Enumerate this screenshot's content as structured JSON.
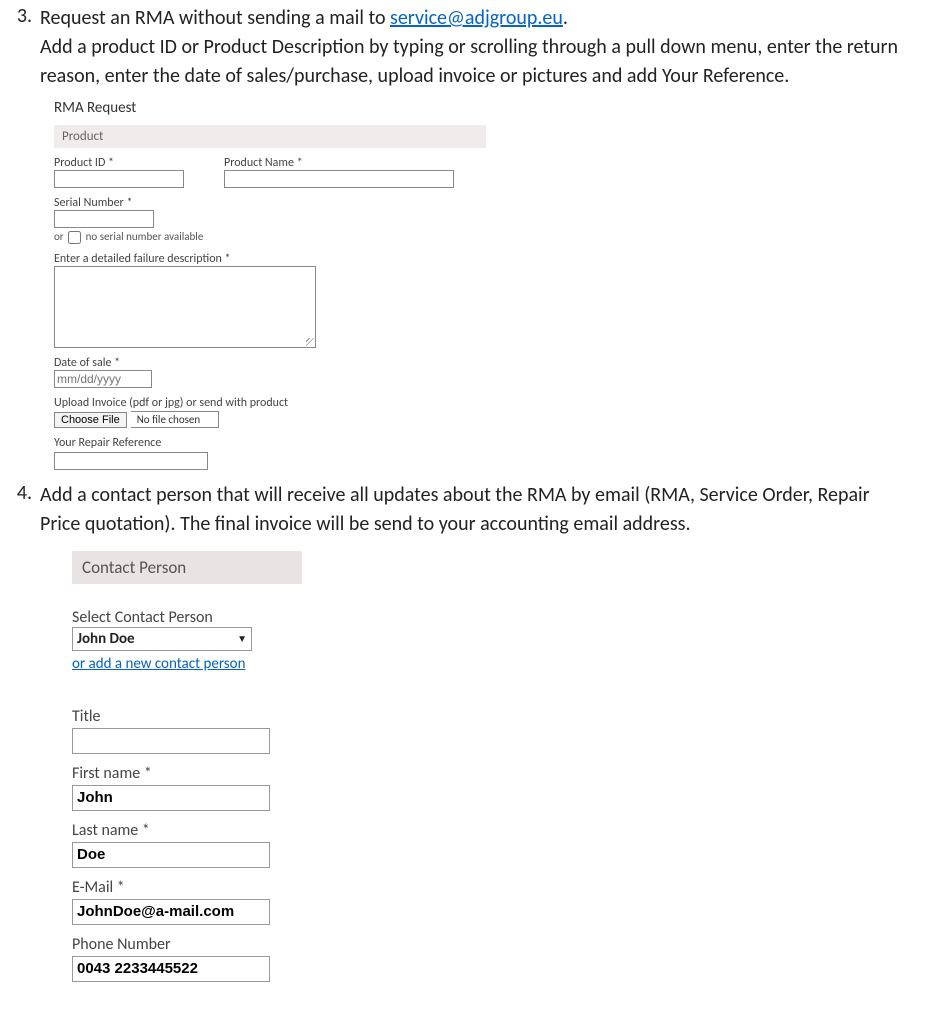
{
  "item3": {
    "num": "3.",
    "line1_a": "Request an RMA without sending a mail to ",
    "line1_link": "service@adjgroup.eu",
    "line1_b": ".",
    "line2": "Add a product ID or Product Description by typing or scrolling through a pull down menu, enter the return reason, enter the date of sales/purchase, upload invoice or pictures and add Your Reference."
  },
  "rma": {
    "title": "RMA Request",
    "section": "Product",
    "product_id_lbl": "Product ID *",
    "product_name_lbl": "Product Name *",
    "serial_lbl": "Serial Number *",
    "no_serial": "no serial number available",
    "or_text": "or",
    "desc_lbl": "Enter a detailed failure description *",
    "date_lbl": "Date of sale *",
    "date_placeholder": "mm/dd/yyyy",
    "upload_lbl": "Upload Invoice (pdf or jpg) or send with product",
    "choose_file": "Choose File",
    "no_file": "No file chosen",
    "ref_lbl": "Your Repair Reference"
  },
  "item4": {
    "num": "4.",
    "text": "Add a contact person that will receive all updates about the RMA by email (RMA, Service Order, Repair Price quotation). The final invoice will be send to your accounting email address."
  },
  "contact": {
    "section": "Contact Person",
    "select_lbl": "Select Contact Person",
    "select_value": "John Doe",
    "add_link": "or add a new contact person",
    "title_lbl": "Title",
    "title_val": "",
    "first_lbl": "First name *",
    "first_val": "John",
    "last_lbl": "Last name *",
    "last_val": "Doe",
    "email_lbl": "E-Mail *",
    "email_val": "JohnDoe@a-mail.com",
    "phone_lbl": "Phone Number",
    "phone_val": "0043 2233445522"
  }
}
